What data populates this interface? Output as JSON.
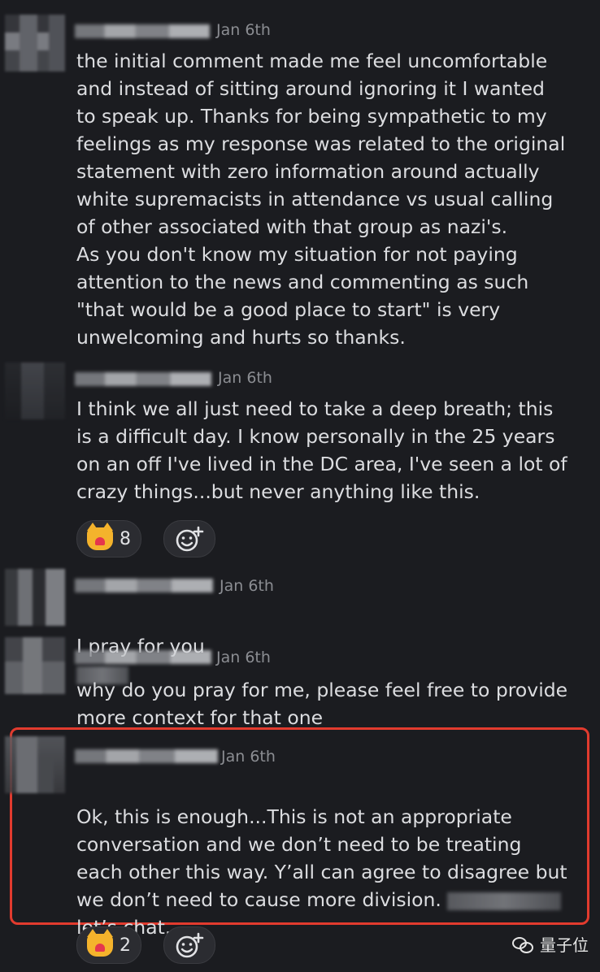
{
  "messages": [
    {
      "date": "Jan 6th",
      "text": "the initial comment made me feel uncomfortable\nand instead of sitting around ignoring it I wanted\nto speak up. Thanks for being sympathetic to my\nfeelings as my response was related to the original\nstatement with zero information around actually\nwhite supremacists in attendance vs usual calling\nof other associated with that group as nazi's.\nAs you don't know my situation for not paying\nattention to the news and commenting as such\n\"that would be a good place to start\"  is very\nunwelcoming and hurts so thanks."
    },
    {
      "date": "Jan 6th",
      "text": "I think we all just need to take a deep breath; this\nis a difficult day.  I know personally in the 25 years\non an off I've lived in the DC area, I've seen a lot of\ncrazy things...but never anything like this.",
      "reaction_count": "8"
    },
    {
      "date": "Jan 6th",
      "text": "I pray for you"
    },
    {
      "date": "Jan 6th",
      "text": "why do you pray for me, please feel free to provide\nmore context for that one"
    },
    {
      "date": "Jan 6th",
      "text_before": "Ok, this is enough...This is not an appropriate\nconversation and we don’t need to be treating\neach other this way. Y’all can agree to disagree but\nwe don’t need to cause more division. ",
      "text_after": "\nlet’s chat.",
      "reaction_count": "2"
    }
  ],
  "watermark": "量子位",
  "colors": {
    "highlight_border": "#e23b2e",
    "background": "#1b1c20"
  },
  "icons": {
    "reaction": "heart-eyes-cat-emoji",
    "add_reaction": "add-emoji-icon"
  }
}
